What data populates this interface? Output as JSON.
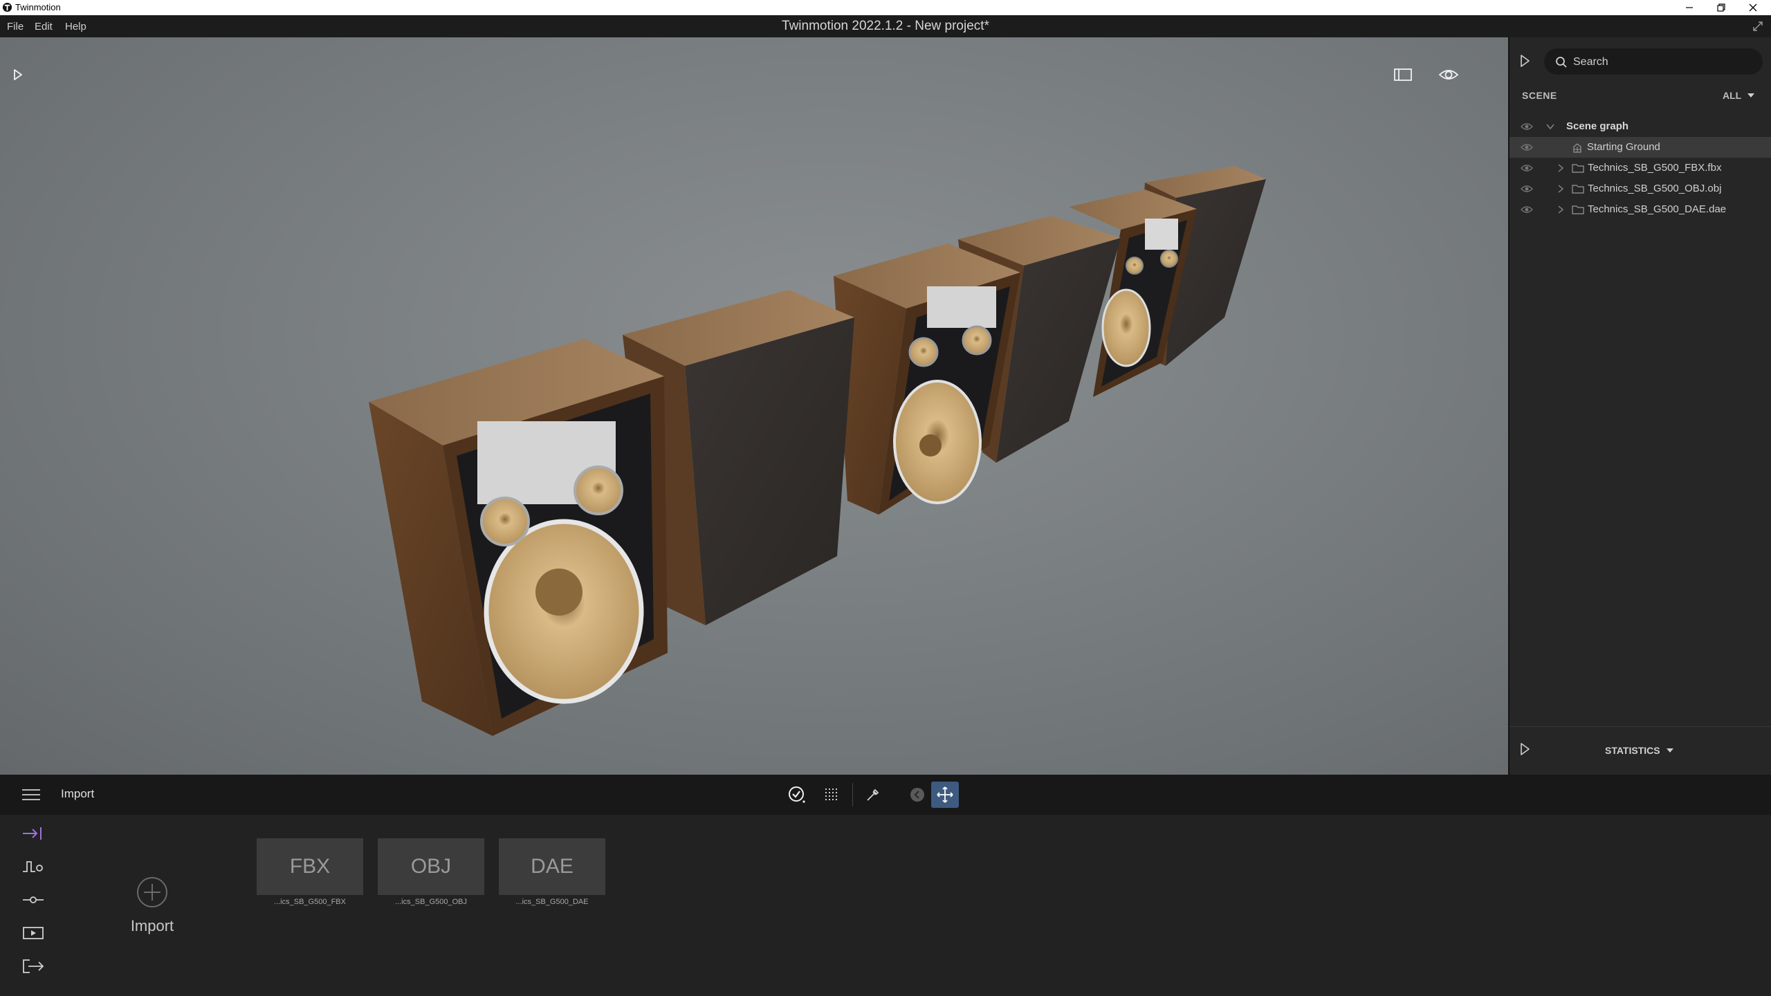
{
  "os_titlebar": {
    "app_name": "Twinmotion",
    "controls": [
      "minimize-icon",
      "restore-icon",
      "close-icon"
    ]
  },
  "menubar": {
    "items": [
      "File",
      "Edit",
      "Help"
    ],
    "window_title": "Twinmotion 2022.1.2 - New project*"
  },
  "viewport": {
    "buttons": [
      "play-icon",
      "layout-icon",
      "visibility-icon"
    ]
  },
  "right_panel": {
    "search": {
      "placeholder": "Search"
    },
    "section_label": "SCENE",
    "filter_label": "ALL",
    "tree": [
      {
        "label": "Scene graph",
        "expanded": true,
        "type": "root"
      },
      {
        "label": "Starting Ground",
        "selected": true,
        "type": "ground"
      },
      {
        "label": "Technics_SB_G500_FBX.fbx",
        "type": "folder",
        "expanded": false
      },
      {
        "label": "Technics_SB_G500_OBJ.obj",
        "type": "folder",
        "expanded": false
      },
      {
        "label": "Technics_SB_G500_DAE.dae",
        "type": "folder",
        "expanded": false
      }
    ],
    "statistics_label": "STATISTICS"
  },
  "bottom_toolbar": {
    "breadcrumb": "Import",
    "tools": [
      "select-icon",
      "grid-icon",
      "eyedropper-icon",
      "back-icon",
      "move-icon"
    ],
    "active_tool": "move-icon"
  },
  "bottom_panel": {
    "side_nav": [
      "import-icon",
      "context-icon",
      "configuration-icon",
      "media-icon",
      "export-icon"
    ],
    "import_label": "Import",
    "assets": [
      {
        "format": "FBX",
        "name": "...ics_SB_G500_FBX"
      },
      {
        "format": "OBJ",
        "name": "...ics_SB_G500_OBJ"
      },
      {
        "format": "DAE",
        "name": "...ics_SB_G500_DAE"
      }
    ]
  },
  "colors": {
    "accent_active_tool": "#3e5a80",
    "import_nav_accent": "#a070e0",
    "panel_bg": "#262626",
    "viewport_bg": "#7b8083"
  }
}
